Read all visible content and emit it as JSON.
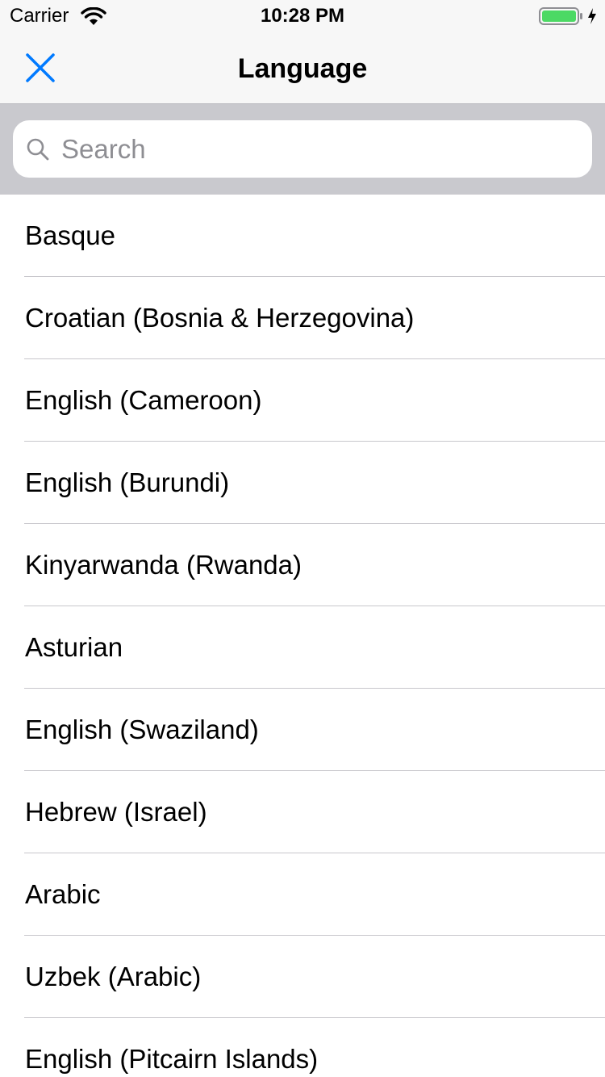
{
  "status_bar": {
    "carrier": "Carrier",
    "time": "10:28 PM",
    "battery_color": "#4cd964"
  },
  "nav": {
    "title": "Language",
    "close_icon": "close-icon",
    "accent_color": "#007aff"
  },
  "search": {
    "placeholder": "Search",
    "value": ""
  },
  "languages": [
    "Basque",
    "Croatian (Bosnia & Herzegovina)",
    "English (Cameroon)",
    "English (Burundi)",
    "Kinyarwanda (Rwanda)",
    "Asturian",
    "English (Swaziland)",
    "Hebrew (Israel)",
    "Arabic",
    "Uzbek (Arabic)",
    "English (Pitcairn Islands)"
  ]
}
